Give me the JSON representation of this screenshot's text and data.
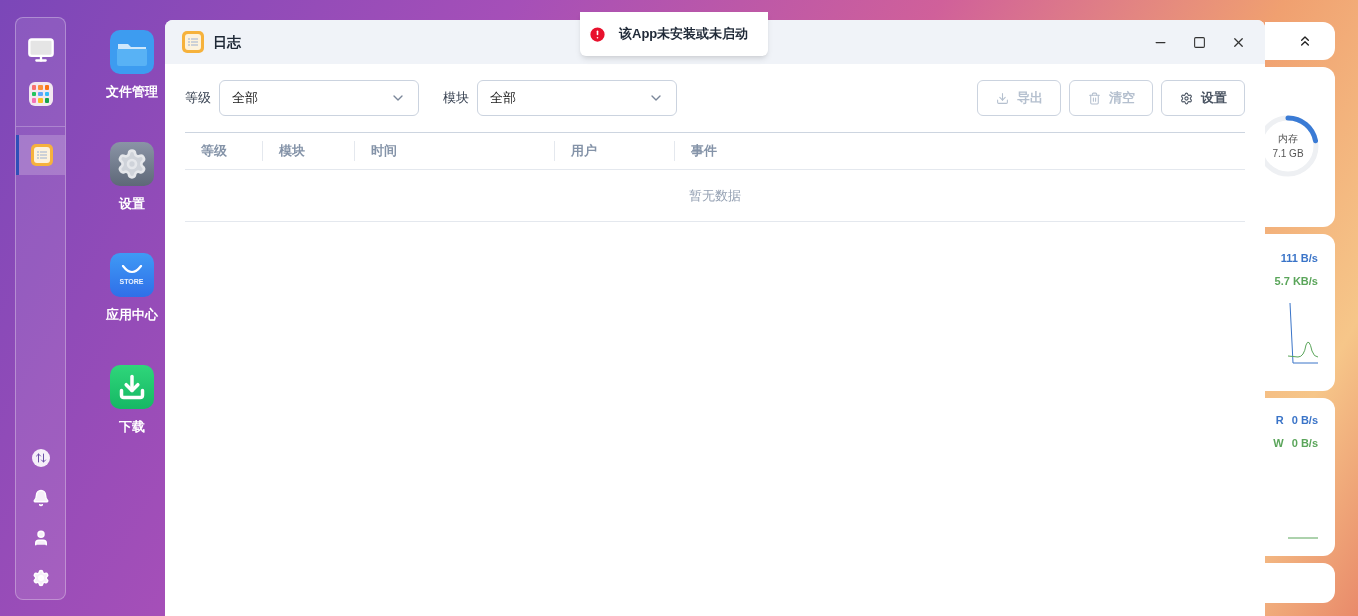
{
  "dock": {
    "top_items": [
      {
        "kind": "monitor",
        "selected": false
      },
      {
        "kind": "apps",
        "selected": false
      }
    ],
    "open_apps": [
      {
        "kind": "log",
        "selected": true
      }
    ],
    "bottom_items": [
      {
        "kind": "transfer"
      },
      {
        "kind": "bell"
      },
      {
        "kind": "user"
      },
      {
        "kind": "gear"
      }
    ]
  },
  "desktop_icons": [
    {
      "kind": "folder",
      "label": "文件管理"
    },
    {
      "kind": "settings",
      "label": "设置"
    },
    {
      "kind": "store",
      "label": "应用中心",
      "badge_text": "STORE"
    },
    {
      "kind": "download",
      "label": "下载"
    }
  ],
  "window": {
    "title": "日志",
    "filters": [
      {
        "label": "等级",
        "value": "全部"
      },
      {
        "label": "模块",
        "value": "全部"
      }
    ],
    "buttons": [
      {
        "kind": "export",
        "label": "导出",
        "disabled": true
      },
      {
        "kind": "clear",
        "label": "清空",
        "disabled": true
      },
      {
        "kind": "settings",
        "label": "设置",
        "disabled": false
      }
    ],
    "table": {
      "columns": [
        "等级",
        "模块",
        "时间",
        "用户",
        "事件"
      ],
      "empty_text": "暂无数据"
    }
  },
  "toast": {
    "text": "该App未安装或未启动"
  },
  "widgets": {
    "memory": {
      "label": "内存",
      "value": "7.1 GB",
      "level": 0.22
    },
    "network": {
      "upload": "111 B/s",
      "download": "5.7 KB/s"
    },
    "disk": {
      "read_label": "R",
      "read": "0 B/s",
      "write_label": "W",
      "write": "0 B/s"
    }
  }
}
